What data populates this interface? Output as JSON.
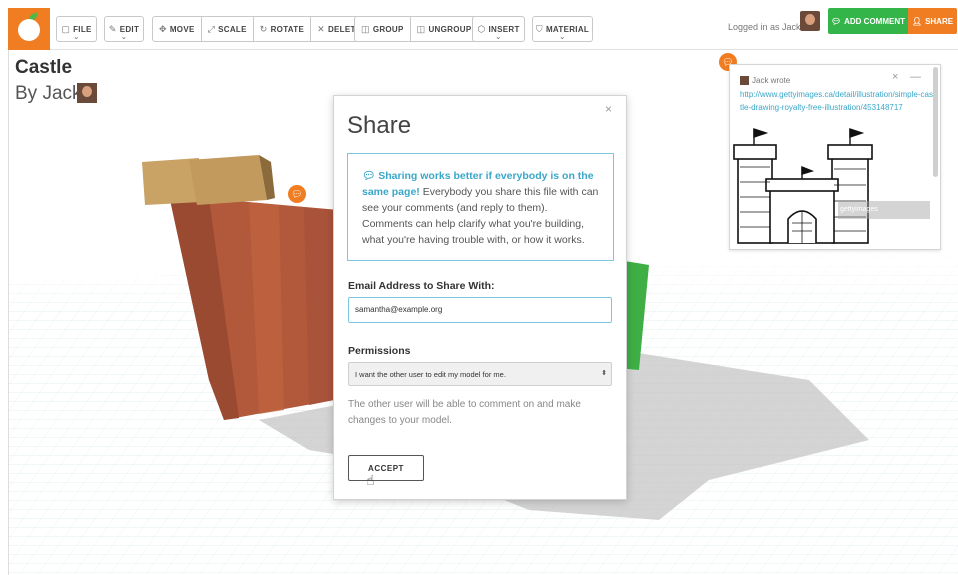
{
  "toolbar": {
    "file": "FILE",
    "edit": "EDIT",
    "move": "MOVE",
    "scale": "SCALE",
    "rotate": "ROTATE",
    "delete": "DELETE",
    "group": "GROUP",
    "ungroup": "UNGROUP",
    "insert": "INSERT",
    "material": "MATERIAL"
  },
  "user": {
    "logged_in": "Logged in as Jack",
    "add_comment": "ADD COMMENT",
    "share": "SHARE"
  },
  "project": {
    "title": "Castle",
    "byline": "By Jack"
  },
  "comment": {
    "author": "Jack wrote",
    "link": "http://www.gettyimages.ca/detail/illustration/simple-castle-drawing-royalty-free-illustration/453148717",
    "watermark": "gettyimages"
  },
  "dialog": {
    "title": "Share",
    "info_highlight": "Sharing works better if everybody is on the same page!",
    "info_body": " Everybody you share this file with can see your comments (and reply to them). Comments can help clarify what you're building, what you're having trouble with, or how it works.",
    "email_label": "Email Address to Share With:",
    "email_value": "samantha@example.org",
    "permissions_label": "Permissions",
    "permissions_selected": "I want the other user to edit my model for me.",
    "note": "The other user will be able to comment on and make changes to your model.",
    "accept": "ACCEPT"
  },
  "colors": {
    "accent_orange": "#f07d22",
    "accent_green": "#33b54a",
    "link_blue": "#3aa7c9"
  }
}
